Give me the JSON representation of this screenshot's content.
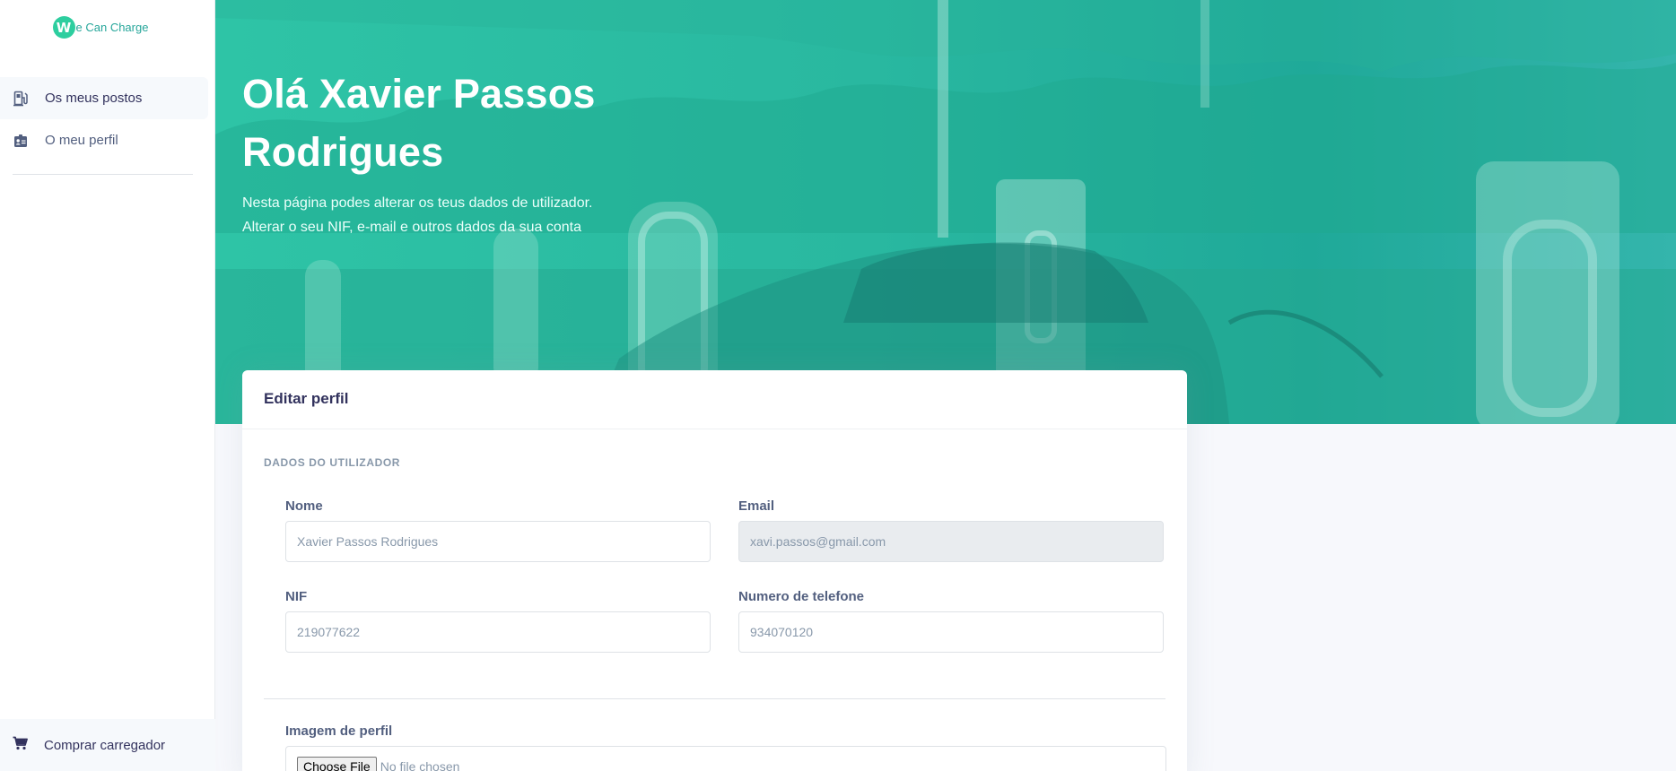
{
  "brand": {
    "name": "e Can Charge",
    "logo_letter": "W"
  },
  "sidebar": {
    "items": [
      {
        "label": "Os meus postos",
        "icon": "charging-station-icon",
        "active": true
      },
      {
        "label": "O meu perfil",
        "icon": "id-card-icon",
        "active": false
      }
    ],
    "bottom_item": {
      "label": "Comprar carregador",
      "icon": "cart-icon"
    }
  },
  "hero": {
    "title": "Olá Xavier Passos Rodrigues",
    "subtitle_line1": "Nesta página podes alterar os teus dados de utilizador.",
    "subtitle_line2": "Alterar o seu NIF, e-mail e outros dados da sua conta",
    "background": "tesla-charging-station-photo"
  },
  "profile_card": {
    "title": "Editar perfil",
    "section_heading": "DADOS DO UTILIZADOR",
    "fields": {
      "name": {
        "label": "Nome",
        "placeholder": "Xavier Passos Rodrigues"
      },
      "email": {
        "label": "Email",
        "placeholder": "xavi.passos@gmail.com",
        "disabled": true
      },
      "nif": {
        "label": "NIF",
        "placeholder": "219077622"
      },
      "phone": {
        "label": "Numero de telefone",
        "placeholder": "934070120"
      }
    },
    "image": {
      "label": "Imagem de perfil",
      "button_label": "Choose File",
      "status": "No file chosen"
    }
  },
  "colors": {
    "accent": "#2dce9f",
    "hero_start": "#2ec4a6",
    "hero_end": "#1fa999",
    "text_dark": "#32325d"
  }
}
